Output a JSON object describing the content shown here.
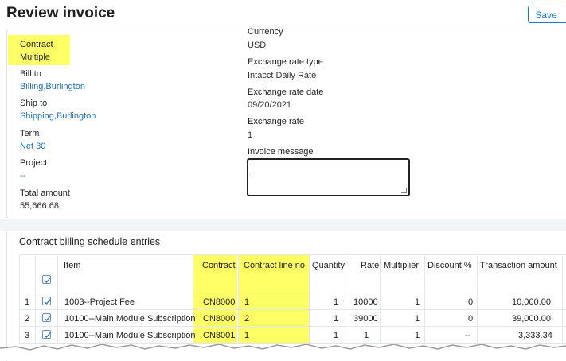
{
  "header": {
    "title": "Review invoice",
    "save_label": "Save"
  },
  "left_fields": [
    {
      "label": "Contract",
      "value": "Multiple",
      "link": false
    },
    {
      "label": "Bill to",
      "value": "Billing,Burlington",
      "link": true
    },
    {
      "label": "Ship to",
      "value": "Shipping,Burlington",
      "link": true
    },
    {
      "label": "Term",
      "value": "Net 30",
      "link": true
    },
    {
      "label": "Project",
      "value": "--",
      "link": true
    },
    {
      "label": "Total amount",
      "value": "55,666.68",
      "link": false
    }
  ],
  "right_fields": [
    {
      "label": "Currency",
      "value": "USD"
    },
    {
      "label": "Exchange rate type",
      "value": "Intacct Daily Rate"
    },
    {
      "label": "Exchange rate date",
      "value": "09/20/2021"
    },
    {
      "label": "Exchange rate",
      "value": "1"
    }
  ],
  "invoice_message": {
    "label": "Invoice message",
    "value": ""
  },
  "section": {
    "title": "Contract billing schedule entries",
    "columns": {
      "item": "Item",
      "contract": "Contract",
      "contract_line_no": "Contract line no",
      "quantity": "Quantity",
      "rate": "Rate",
      "multiplier": "Multiplier",
      "discount": "Discount %",
      "transaction_amount": "Transaction amount"
    },
    "rows": [
      {
        "num": "1",
        "item": "1003--Project Fee",
        "contract": "CN8000",
        "line_no": "1",
        "quantity": "1",
        "rate": "10000",
        "multiplier": "1",
        "discount": "0",
        "amount": "10,000.00"
      },
      {
        "num": "2",
        "item": "10100--Main Module Subscription",
        "contract": "CN8000",
        "line_no": "2",
        "quantity": "1",
        "rate": "39000",
        "multiplier": "1",
        "discount": "0",
        "amount": "39,000.00"
      },
      {
        "num": "3",
        "item": "10100--Main Module Subscription",
        "contract": "CN8001",
        "line_no": "1",
        "quantity": "1",
        "rate": "1",
        "multiplier": "1",
        "discount": "--",
        "amount": "3,333.34"
      }
    ]
  },
  "colors": {
    "highlight": "#ffff66",
    "link": "#1f6fb5",
    "accent": "#1f7bbf"
  }
}
